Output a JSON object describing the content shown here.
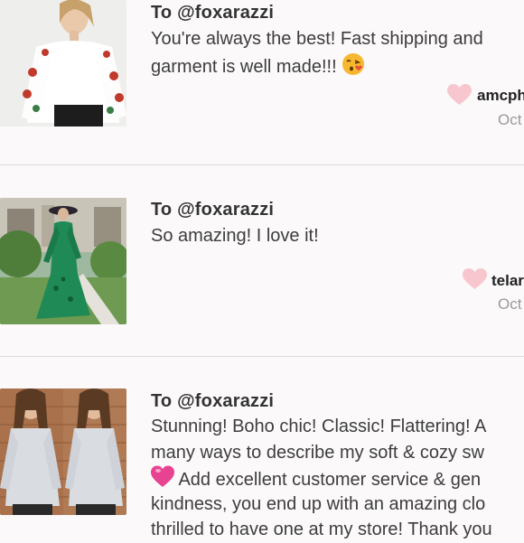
{
  "reviews": [
    {
      "to": "To @foxarazzi",
      "lines": [
        "You're always the best! Fast shipping and",
        "garment is well made!!!"
      ],
      "emoji_icon": "kissing-face-heart-emoji",
      "user": "amcph",
      "date": "Oct"
    },
    {
      "to": "To @foxarazzi",
      "lines": [
        "So amazing! I love it!"
      ],
      "user": "telar",
      "date": "Oct"
    },
    {
      "to": "To @foxarazzi",
      "lines": [
        "Stunning! Boho chic! Classic! Flattering! A",
        "many ways to describe my soft & cozy sw",
        "Add excellent customer service & gen",
        "kindness, you end up with an amazing clo",
        "thrilled to have one at my store! Thank you"
      ],
      "emoji_icon": "pink-heart-emoji",
      "user": "",
      "date": ""
    }
  ],
  "colors": {
    "heart": "#f7c6cf",
    "divider": "#dcd9d9",
    "background": "#fbf9f9"
  }
}
